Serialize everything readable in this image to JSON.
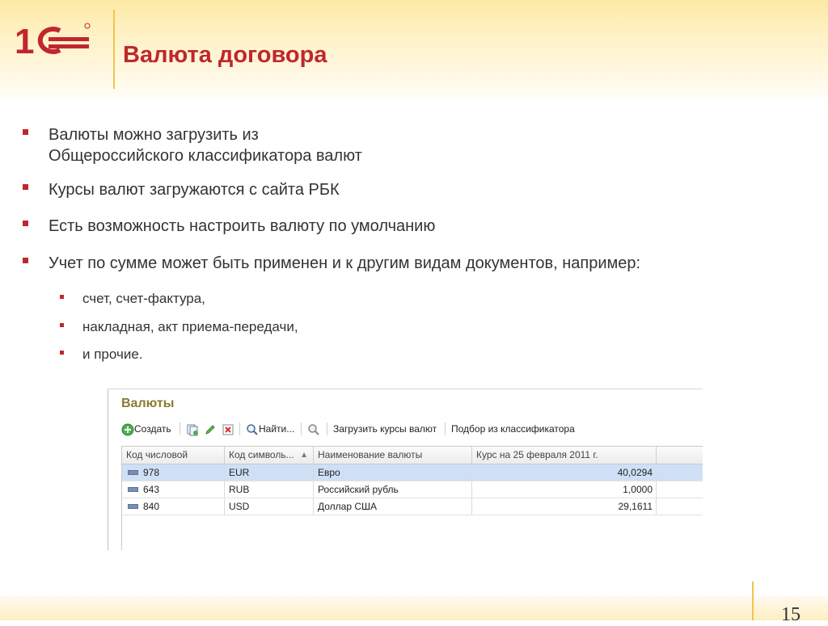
{
  "slide": {
    "title": "Валюта договора",
    "page_number": "15",
    "logo_text": "1С",
    "colors": {
      "accent": "#c0272d",
      "header_band": "#fde9a6",
      "separator": "#f1c34a"
    }
  },
  "bullets": [
    {
      "text_line1": "Валюты можно загрузить из",
      "text_line2": "Общероссийского классификатора валют"
    },
    {
      "text": "Курсы валют загружаются с сайта РБК"
    },
    {
      "text": "Есть возможность настроить валюту по умолчанию"
    },
    {
      "text": "Учет по сумме может быть применен и к другим видам документов, например:"
    }
  ],
  "sub_bullets": [
    {
      "text": "счет, счет-фактура,"
    },
    {
      "text": "накладная, акт приема-передачи,"
    },
    {
      "text": "и прочие."
    }
  ],
  "window": {
    "title": "Валюты",
    "toolbar": {
      "create_label": "Создать",
      "find_label": "Найти...",
      "load_rates_label": "Загрузить курсы валют",
      "pick_from_classifier_label": "Подбор из классификатора",
      "icons": [
        "plus-circle-icon",
        "copy-icon",
        "edit-icon",
        "delete-icon",
        "search-icon",
        "clear-search-icon"
      ]
    },
    "table": {
      "headers": [
        "Код числовой",
        "Код символь...",
        "Наименование валюты",
        "Курс на 25 февраля 2011 г."
      ],
      "rows": [
        {
          "num_code": "978",
          "sym_code": "EUR",
          "name": "Евро",
          "rate": "40,0294",
          "selected": true
        },
        {
          "num_code": "643",
          "sym_code": "RUB",
          "name": "Российский рубль",
          "rate": "1,0000",
          "selected": false
        },
        {
          "num_code": "840",
          "sym_code": "USD",
          "name": "Доллар США",
          "rate": "29,1611",
          "selected": false
        }
      ]
    }
  }
}
